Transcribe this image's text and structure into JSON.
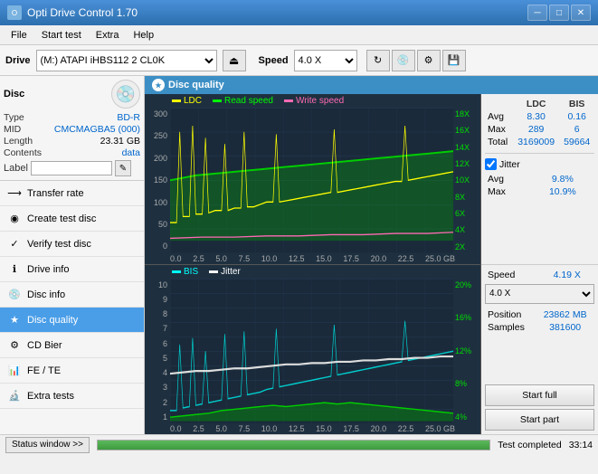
{
  "titleBar": {
    "title": "Opti Drive Control 1.70",
    "minButton": "─",
    "maxButton": "□",
    "closeButton": "✕"
  },
  "menuBar": {
    "items": [
      "File",
      "Start test",
      "Extra",
      "Help"
    ]
  },
  "driveBar": {
    "driveLabel": "Drive",
    "driveValue": "(M:) ATAPI iHBS112  2 CL0K",
    "speedLabel": "Speed",
    "speedValue": "4.0 X"
  },
  "disc": {
    "title": "Disc",
    "typeLabel": "Type",
    "typeValue": "BD-R",
    "midLabel": "MID",
    "midValue": "CMCMAGBA5 (000)",
    "lengthLabel": "Length",
    "lengthValue": "23.31 GB",
    "contentsLabel": "Contents",
    "contentsValue": "data",
    "labelLabel": "Label",
    "labelValue": ""
  },
  "nav": {
    "items": [
      {
        "id": "transfer-rate",
        "label": "Transfer rate",
        "icon": "⟶"
      },
      {
        "id": "create-test-disc",
        "label": "Create test disc",
        "icon": "◉"
      },
      {
        "id": "verify-test-disc",
        "label": "Verify test disc",
        "icon": "✓"
      },
      {
        "id": "drive-info",
        "label": "Drive info",
        "icon": "ℹ"
      },
      {
        "id": "disc-info",
        "label": "Disc info",
        "icon": "💿"
      },
      {
        "id": "disc-quality",
        "label": "Disc quality",
        "icon": "★",
        "active": true
      },
      {
        "id": "cd-bier",
        "label": "CD Bier",
        "icon": "⚙"
      },
      {
        "id": "fe-te",
        "label": "FE / TE",
        "icon": "📊"
      },
      {
        "id": "extra-tests",
        "label": "Extra tests",
        "icon": "🔬"
      }
    ]
  },
  "chart": {
    "title": "Disc quality",
    "topLegend": [
      {
        "label": "LDC",
        "color": "#ffff00"
      },
      {
        "label": "Read speed",
        "color": "#00ff00"
      },
      {
        "label": "Write speed",
        "color": "#ff69b4"
      }
    ],
    "bottomLegend": [
      {
        "label": "BIS",
        "color": "#00ffff"
      },
      {
        "label": "Jitter",
        "color": "#ffffff"
      }
    ],
    "topYLabels": [
      "300",
      "250",
      "200",
      "150",
      "100",
      "50",
      "0"
    ],
    "topYLabelsRight": [
      "18X",
      "16X",
      "14X",
      "12X",
      "10X",
      "8X",
      "6X",
      "4X",
      "2X"
    ],
    "bottomYLabels": [
      "10",
      "9",
      "8",
      "7",
      "6",
      "5",
      "4",
      "3",
      "2",
      "1"
    ],
    "bottomYLabelsRight": [
      "20%",
      "16%",
      "12%",
      "8%",
      "4%"
    ],
    "xLabels": [
      "0.0",
      "2.5",
      "5.0",
      "7.5",
      "10.0",
      "12.5",
      "15.0",
      "17.5",
      "20.0",
      "22.5",
      "25.0 GB"
    ]
  },
  "stats": {
    "columns": [
      "",
      "LDC",
      "BIS",
      "",
      "Jitter",
      "Speed",
      ""
    ],
    "avg": {
      "label": "Avg",
      "ldc": "8.30",
      "bis": "0.16",
      "jitter": "9.8%"
    },
    "max": {
      "label": "Max",
      "ldc": "289",
      "bis": "6",
      "jitter": "10.9%"
    },
    "total": {
      "label": "Total",
      "ldc": "3169009",
      "bis": "59664"
    },
    "jitterCheck": true,
    "speed": {
      "label": "Speed",
      "value": "4.19 X",
      "selectValue": "4.0 X"
    },
    "position": {
      "label": "Position",
      "value": "23862 MB"
    },
    "samples": {
      "label": "Samples",
      "value": "381600"
    },
    "startFullBtn": "Start full",
    "startPartBtn": "Start part"
  },
  "statusBar": {
    "statusWindowBtn": "Status window >>",
    "progressValue": 100,
    "statusText": "Test completed",
    "time": "33:14"
  }
}
